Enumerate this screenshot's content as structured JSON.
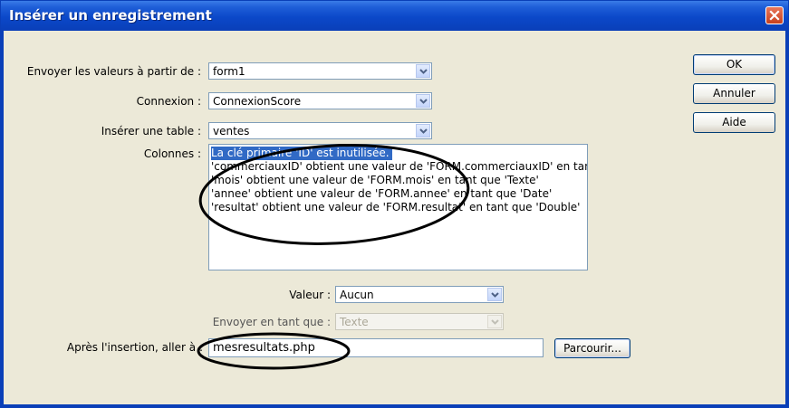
{
  "window": {
    "title": "Insérer un enregistrement"
  },
  "form": {
    "envoyer_label": "Envoyer les valeurs à partir de :",
    "envoyer_value": "form1",
    "connexion_label": "Connexion :",
    "connexion_value": "ConnexionScore",
    "table_label": "Insérer une table :",
    "table_value": "ventes",
    "colonnes_label": "Colonnes :",
    "colonnes": [
      "La clé primaire 'ID' est inutilisée.",
      "'commerciauxID' obtient une valeur de 'FORM.commerciauxID' en tant que",
      "'mois' obtient une valeur de 'FORM.mois' en tant que 'Texte'",
      "'annee' obtient une valeur de 'FORM.annee' en tant que 'Date'",
      "'resultat' obtient une valeur de 'FORM.resultat' en tant que 'Double'"
    ],
    "valeur_label": "Valeur :",
    "valeur_value": "Aucun",
    "envoyer_tant_label": "Envoyer en tant que :",
    "envoyer_tant_value": "Texte",
    "apres_label": "Après l'insertion, aller à :",
    "apres_value": "mesresultats.php",
    "parcourir_label": "Parcourir..."
  },
  "buttons": {
    "ok": "OK",
    "annuler": "Annuler",
    "aide": "Aide"
  },
  "colors": {
    "titlebar": "#0a3fb8",
    "selection": "#316ac5",
    "face": "#ece9d8"
  }
}
